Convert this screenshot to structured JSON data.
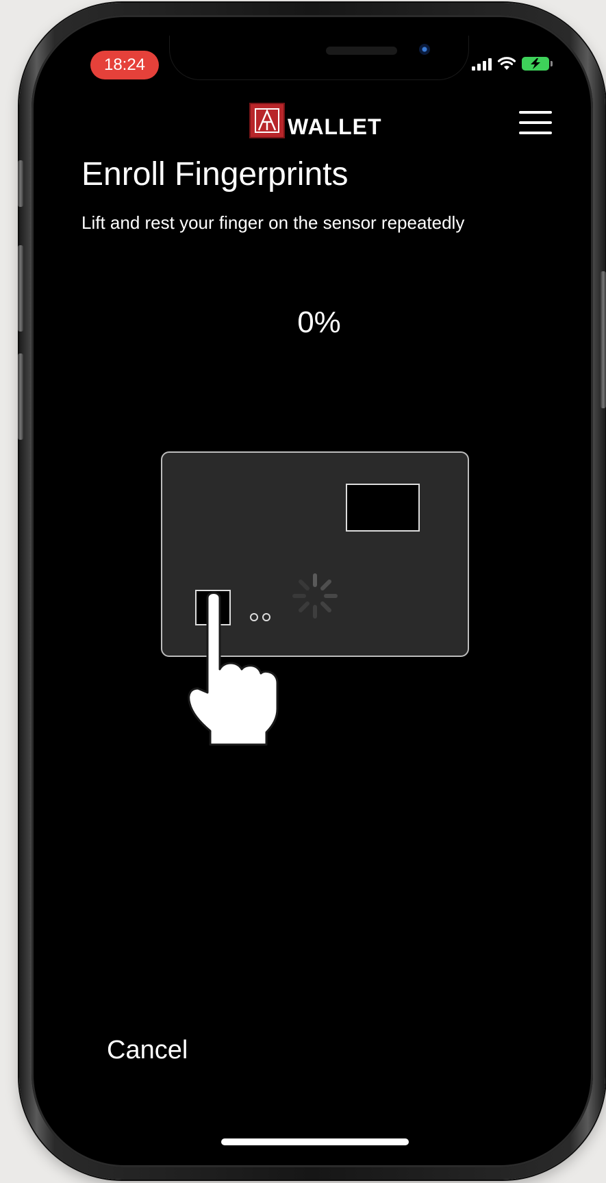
{
  "status_bar": {
    "time": "18:24",
    "signal_icon": "cellular-signal-icon",
    "wifi_icon": "wifi-icon",
    "battery_icon": "battery-charging-icon",
    "time_pill_color": "#e5413a",
    "battery_color": "#3ed15a"
  },
  "header": {
    "logo_letter": "A",
    "logo_text": "WALLET",
    "logo_color": "#b8262a",
    "menu_icon": "hamburger-menu-icon"
  },
  "main": {
    "title": "Enroll Fingerprints",
    "subtitle": "Lift and rest your finger on the sensor repeatedly",
    "progress_percent_label": "0%",
    "progress": 0
  },
  "illustration": {
    "card_icon": "card-icon",
    "chip_icon": "card-chip-icon",
    "sensor_icon": "fingerprint-sensor-icon",
    "spinner_icon": "loading-spinner-icon",
    "hand_icon": "pointing-hand-icon"
  },
  "footer": {
    "cancel_label": "Cancel"
  }
}
